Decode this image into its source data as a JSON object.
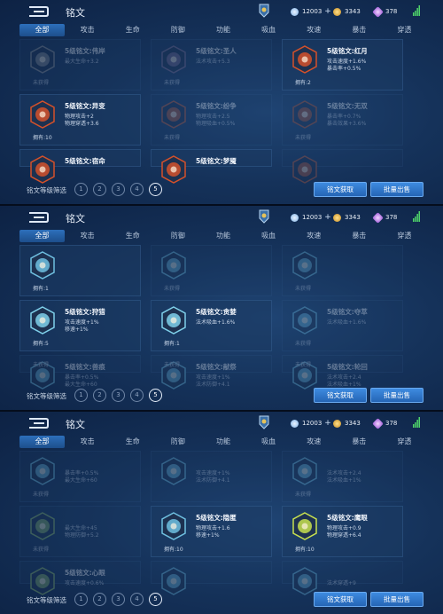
{
  "panels": [
    {
      "title": "铭文",
      "resources": {
        "gold": "12003",
        "coupon": "3343",
        "gem": "378"
      },
      "tabs": [
        "全部",
        "攻击",
        "生命",
        "防御",
        "功能",
        "吸血",
        "攻速",
        "暴击",
        "穿透"
      ],
      "cards": [
        {
          "name": "5级铭文:伟岸",
          "s1": "最大生命+3.2",
          "s2": "",
          "own": "未获得",
          "dim": true,
          "color": "#8a8f96"
        },
        {
          "name": "5级铭文:圣人",
          "s1": "法术攻击+5.3",
          "s2": "",
          "own": "未获得",
          "dim": true,
          "color": "#7b6a8f"
        },
        {
          "name": "5级铭文:红月",
          "s1": "攻击速度+1.6%",
          "s2": "暴击率+0.5%",
          "own": "拥有:2",
          "dim": false,
          "color": "#d4512a"
        },
        {
          "name": "5级铭文:异变",
          "s1": "物理攻击+2",
          "s2": "物理穿透+3.6",
          "own": "拥有:10",
          "dim": false,
          "color": "#d4512a"
        },
        {
          "name": "5级铭文:纷争",
          "s1": "物理攻击+2.5",
          "s2": "物理吸血+0.5%",
          "own": "未获得",
          "dim": true,
          "color": "#c05b3a"
        },
        {
          "name": "5级铭文:无双",
          "s1": "暴击率+0.7%",
          "s2": "暴击效果+3.6%",
          "own": "未获得",
          "dim": true,
          "color": "#b8532f"
        },
        {
          "name": "5级铭文:宿命",
          "s1": "",
          "s2": "",
          "own": "",
          "dim": false,
          "color": "#d4512a"
        },
        {
          "name": "5级铭文:梦魇",
          "s1": "",
          "s2": "",
          "own": "",
          "dim": false,
          "color": "#d4512a"
        },
        {
          "name": "",
          "s1": "",
          "s2": "",
          "own": "",
          "dim": true,
          "color": "#c05b3a"
        }
      ],
      "filter_label": "铭文等级筛选",
      "levels": [
        "1",
        "2",
        "3",
        "4",
        "5"
      ],
      "btn_obtain": "铭文获取",
      "btn_sell": "批量出售"
    },
    {
      "title": "铭文",
      "resources": {
        "gold": "12003",
        "coupon": "3343",
        "gem": "378"
      },
      "tabs": [
        "全部",
        "攻击",
        "生命",
        "防御",
        "功能",
        "吸血",
        "攻速",
        "暴击",
        "穿透"
      ],
      "cards": [
        {
          "name": "",
          "s1": "",
          "s2": "",
          "own": "拥有:1",
          "dim": false,
          "color": "#6fbfe0"
        },
        {
          "name": "",
          "s1": "",
          "s2": "",
          "own": "未获得",
          "dim": true,
          "color": "#6fbfe0"
        },
        {
          "name": "",
          "s1": "",
          "s2": "",
          "own": "未获得",
          "dim": true,
          "color": "#6fbfe0"
        },
        {
          "name": "5级铭文:狩猎",
          "s1": "攻击速度+1%",
          "s2": "移速+1%",
          "own": "拥有:5",
          "dim": false,
          "color": "#7fd0ea"
        },
        {
          "name": "5级铭文:贪婪",
          "s1": "法术吸血+1.6%",
          "s2": "",
          "own": "拥有:1",
          "dim": false,
          "color": "#7fd0ea"
        },
        {
          "name": "5级铭文:夺萃",
          "s1": "法术吸血+1.6%",
          "s2": "",
          "own": "未获得",
          "dim": true,
          "color": "#6fbfe0"
        },
        {
          "name": "5级铭文:兽痕",
          "s1": "暴击率+0.5%",
          "s2": "最大生命+60",
          "own": "未获得",
          "dim": true,
          "color": "#6fbfe0"
        },
        {
          "name": "5级铭文:献祭",
          "s1": "攻击速度+1%",
          "s2": "法术防御+4.1",
          "own": "未获得",
          "dim": true,
          "color": "#6fbfe0"
        },
        {
          "name": "5级铭文:轮回",
          "s1": "法术攻击+2.4",
          "s2": "法术吸血+1%",
          "own": "未获得",
          "dim": true,
          "color": "#6fbfe0"
        }
      ],
      "filter_label": "铭文等级筛选",
      "levels": [
        "1",
        "2",
        "3",
        "4",
        "5"
      ],
      "btn_obtain": "铭文获取",
      "btn_sell": "批量出售"
    },
    {
      "title": "铭文",
      "resources": {
        "gold": "12003",
        "coupon": "3343",
        "gem": "378"
      },
      "tabs": [
        "全部",
        "攻击",
        "生命",
        "防御",
        "功能",
        "吸血",
        "攻速",
        "暴击",
        "穿透"
      ],
      "cards": [
        {
          "name": "",
          "s1": "暴击率+0.5%",
          "s2": "最大生命+60",
          "own": "未获得",
          "dim": true,
          "color": "#6fbfe0"
        },
        {
          "name": "",
          "s1": "攻击速度+1%",
          "s2": "法术防御+4.1",
          "own": "",
          "dim": true,
          "color": "#6fbfe0"
        },
        {
          "name": "",
          "s1": "法术攻击+2.4",
          "s2": "法术吸血+1%",
          "own": "未获得",
          "dim": true,
          "color": "#6fbfe0"
        },
        {
          "name": "",
          "s1": "最大生命+45",
          "s2": "物理防御+5.2",
          "own": "未获得",
          "dim": true,
          "color": "#8ab86a"
        },
        {
          "name": "5级铭文:隐匿",
          "s1": "物理攻击+1.6",
          "s2": "移速+1%",
          "own": "拥有:10",
          "dim": false,
          "color": "#6fbfe0"
        },
        {
          "name": "5级铭文:鹰眼",
          "s1": "物理攻击+0.9",
          "s2": "物理穿透+6.4",
          "own": "拥有:10",
          "dim": false,
          "color": "#c7e04f"
        },
        {
          "name": "5级铭文:心眼",
          "s1": "攻击速度+0.6%",
          "s2": "",
          "own": "",
          "dim": true,
          "color": "#8ab86a"
        },
        {
          "name": "",
          "s1": "",
          "s2": "",
          "own": "",
          "dim": true,
          "color": "#6fbfe0"
        },
        {
          "name": "",
          "s1": "法术穿透+9",
          "s2": "",
          "own": "",
          "dim": true,
          "color": "#6fbfe0"
        }
      ],
      "filter_label": "铭文等级筛选",
      "levels": [
        "1",
        "2",
        "3",
        "4",
        "5"
      ],
      "btn_obtain": "铭文获取",
      "btn_sell": "批量出售"
    }
  ]
}
